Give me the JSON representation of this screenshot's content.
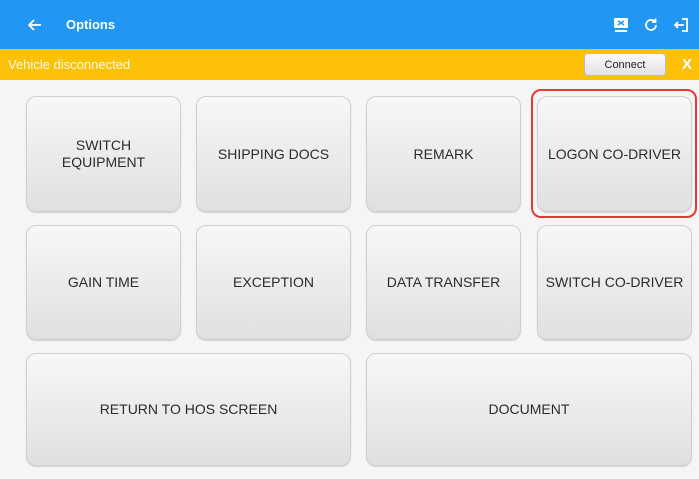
{
  "appbar": {
    "title": "Options",
    "back_icon": "arrow-left",
    "actions": [
      "device-icon",
      "refresh-icon",
      "logout-icon"
    ]
  },
  "banner": {
    "message": "Vehicle disconnected",
    "connect_label": "Connect",
    "close_label": "X"
  },
  "tiles": {
    "switch_equipment": "SWITCH EQUIPMENT",
    "shipping_docs": "SHIPPING DOCS",
    "remark": "REMARK",
    "logon_co_driver": "LOGON CO-DRIVER",
    "gain_time": "GAIN TIME",
    "exception": "EXCEPTION",
    "data_transfer": "DATA TRANSFER",
    "switch_co_driver": "SWITCH CO-DRIVER",
    "return_to_hos": "RETURN TO HOS SCREEN",
    "document": "DOCUMENT"
  },
  "colors": {
    "appbar": "#2196f3",
    "banner": "#ffc107",
    "highlight": "#e53935"
  }
}
